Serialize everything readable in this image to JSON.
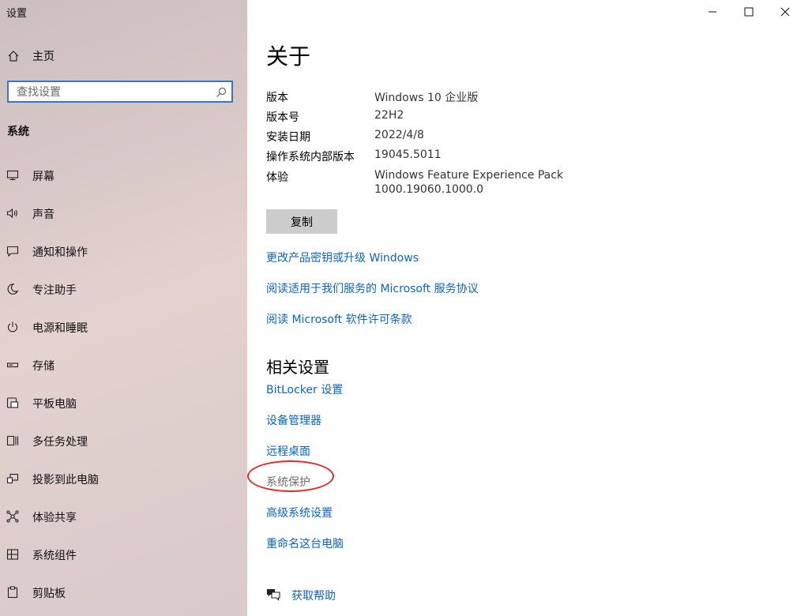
{
  "app": {
    "title": "设置"
  },
  "sidebar": {
    "home_label": "主页",
    "search_placeholder": "查找设置",
    "section_title": "系统",
    "items": [
      {
        "label": "屏幕",
        "icon": "monitor-icon"
      },
      {
        "label": "声音",
        "icon": "speaker-icon"
      },
      {
        "label": "通知和操作",
        "icon": "notification-icon"
      },
      {
        "label": "专注助手",
        "icon": "moon-icon"
      },
      {
        "label": "电源和睡眠",
        "icon": "power-icon"
      },
      {
        "label": "存储",
        "icon": "storage-icon"
      },
      {
        "label": "平板电脑",
        "icon": "tablet-icon"
      },
      {
        "label": "多任务处理",
        "icon": "multitask-icon"
      },
      {
        "label": "投影到此电脑",
        "icon": "project-icon"
      },
      {
        "label": "体验共享",
        "icon": "share-icon"
      },
      {
        "label": "系统组件",
        "icon": "components-icon"
      },
      {
        "label": "剪贴板",
        "icon": "clipboard-icon"
      }
    ]
  },
  "main": {
    "title": "关于",
    "specs": [
      {
        "key": "版本",
        "value": "Windows 10 企业版"
      },
      {
        "key": "版本号",
        "value": "22H2"
      },
      {
        "key": "安装日期",
        "value": "2022/4/8"
      },
      {
        "key": "操作系统内部版本",
        "value": "19045.5011"
      },
      {
        "key": "体验",
        "value": "Windows Feature Experience Pack",
        "value2": "1000.19060.1000.0"
      }
    ],
    "copy_label": "复制",
    "links": [
      "更改产品密钥或升级 Windows",
      "阅读适用于我们服务的 Microsoft 服务协议",
      "阅读 Microsoft 软件许可条款"
    ],
    "related_title": "相关设置",
    "related": [
      "BitLocker 设置",
      "设备管理器",
      "远程桌面",
      "系统保护",
      "高级系统设置",
      "重命名这台电脑"
    ],
    "help_label": "获取帮助"
  },
  "colors": {
    "accent": "#0a64c0",
    "search_border": "#3279c8",
    "annotation": "#e02a2a"
  }
}
